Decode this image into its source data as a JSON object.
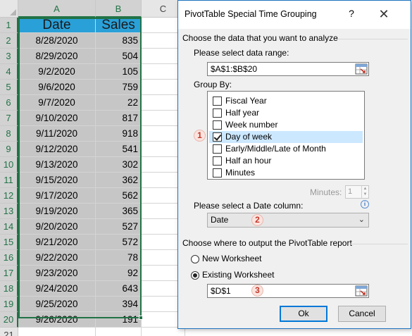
{
  "sheet": {
    "columns": [
      "A",
      "B",
      "C"
    ],
    "rows": [
      "1",
      "2",
      "3",
      "4",
      "5",
      "6",
      "7",
      "8",
      "9",
      "10",
      "11",
      "12",
      "13",
      "14",
      "15",
      "16",
      "17",
      "18",
      "19",
      "20",
      "21"
    ],
    "headers": {
      "date": "Date",
      "sales": "Sales"
    },
    "data": [
      {
        "date": "8/28/2020",
        "sales": "835"
      },
      {
        "date": "8/29/2020",
        "sales": "504"
      },
      {
        "date": "9/2/2020",
        "sales": "105"
      },
      {
        "date": "9/6/2020",
        "sales": "759"
      },
      {
        "date": "9/7/2020",
        "sales": "22"
      },
      {
        "date": "9/10/2020",
        "sales": "817"
      },
      {
        "date": "9/11/2020",
        "sales": "918"
      },
      {
        "date": "9/12/2020",
        "sales": "541"
      },
      {
        "date": "9/13/2020",
        "sales": "302"
      },
      {
        "date": "9/15/2020",
        "sales": "362"
      },
      {
        "date": "9/17/2020",
        "sales": "562"
      },
      {
        "date": "9/19/2020",
        "sales": "365"
      },
      {
        "date": "9/20/2020",
        "sales": "527"
      },
      {
        "date": "9/21/2020",
        "sales": "572"
      },
      {
        "date": "9/22/2020",
        "sales": "78"
      },
      {
        "date": "9/23/2020",
        "sales": "92"
      },
      {
        "date": "9/24/2020",
        "sales": "643"
      },
      {
        "date": "9/25/2020",
        "sales": "394"
      },
      {
        "date": "9/26/2020",
        "sales": "191"
      }
    ],
    "colors": {
      "header_fill": "#2aa0d8",
      "selection_fill": "#c6c6c6",
      "selection_border": "#217346"
    }
  },
  "dialog": {
    "title": "PivotTable Special Time Grouping",
    "help_label": "?",
    "close_label": "✕",
    "section1_label": "Choose the data that you want to analyze",
    "range_label": "Please select data range:",
    "range_value": "$A$1:$B$20",
    "group_by_label": "Group By:",
    "group_options": [
      {
        "label": "Fiscal Year",
        "checked": false
      },
      {
        "label": "Half year",
        "checked": false
      },
      {
        "label": "Week number",
        "checked": false
      },
      {
        "label": "Day of week",
        "checked": true
      },
      {
        "label": "Early/Middle/Late of Month",
        "checked": false
      },
      {
        "label": "Half an hour",
        "checked": false
      },
      {
        "label": "Minutes",
        "checked": false
      }
    ],
    "minutes_label": "Minutes:",
    "minutes_value": "1",
    "date_col_label": "Please select a Date column:",
    "date_col_value": "Date",
    "info_icon": "i",
    "section2_label": "Choose where to output the PivotTable report",
    "output_options": [
      {
        "label": "New Worksheet",
        "selected": false
      },
      {
        "label": "Existing Worksheet",
        "selected": true
      }
    ],
    "output_value": "$D$1",
    "ok_label": "Ok",
    "cancel_label": "Cancel",
    "badges": [
      "1",
      "2",
      "3"
    ]
  }
}
